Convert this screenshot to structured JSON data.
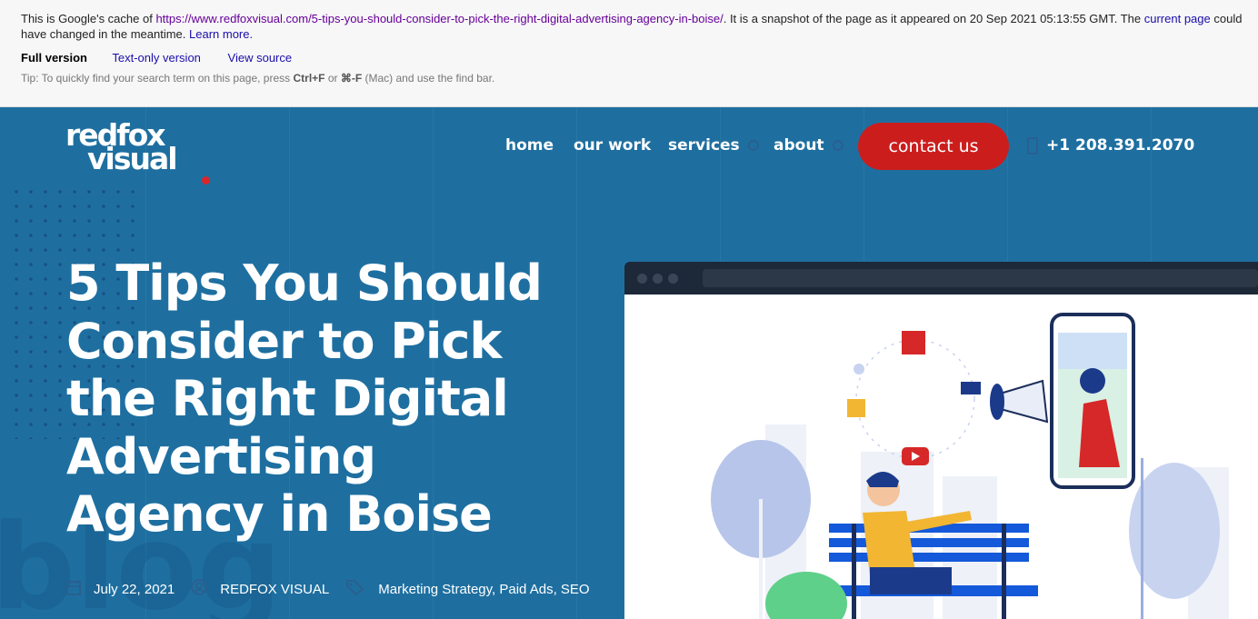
{
  "cache": {
    "prefix": "This is Google's cache of ",
    "url": "https://www.redfoxvisual.com/5-tips-you-should-consider-to-pick-the-right-digital-advertising-agency-in-boise/",
    "middle": ". It is a snapshot of the page as it appeared on 20 Sep 2021 05:13:55 GMT. The ",
    "current_page": "current page",
    "suffix": " could have changed in the meantime. ",
    "learn_more": "Learn more.",
    "full_version": "Full version",
    "text_only": "Text-only version",
    "view_source": "View source",
    "tip_prefix": "Tip: To quickly find your search term on this page, press ",
    "tip_key1": "Ctrl+F",
    "tip_or": " or ",
    "tip_key2": "⌘-F",
    "tip_suffix": " (Mac) and use the find bar."
  },
  "logo": {
    "line1": "redfox",
    "line2": "visual"
  },
  "nav": {
    "home": "home",
    "our_work": "our work",
    "services": "services",
    "about": "about",
    "contact": "contact us",
    "phone": "+1 208.391.2070"
  },
  "hero": {
    "title_lines": [
      "5 Tips You Should",
      "Consider to Pick",
      "the Right Digital",
      "Advertising",
      "Agency in Boise"
    ],
    "date": "July 22, 2021",
    "author": "REDFOX VISUAL",
    "categories": "Marketing Strategy, Paid Ads, SEO",
    "watermark": "blog"
  },
  "colors": {
    "hero_bg": "#1e6fa0",
    "contact_bg": "#cc1d1d",
    "link": "#1a0dab",
    "visited_link": "#660099"
  },
  "icons": {
    "date": "calendar-icon",
    "author": "user-icon",
    "categories": "tag-icon",
    "phone": "phone-icon"
  }
}
